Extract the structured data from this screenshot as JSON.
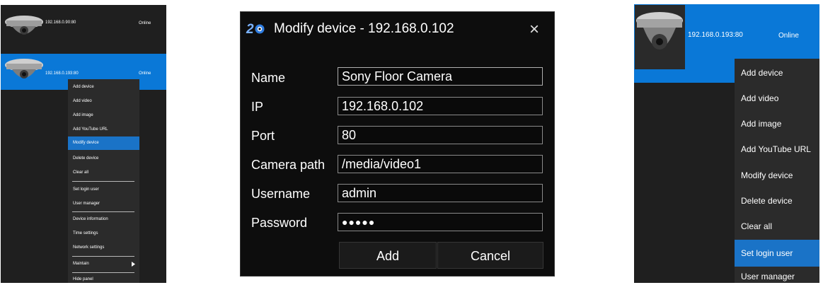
{
  "left": {
    "devices": [
      {
        "ip": "192.168.0.90:80",
        "status": "Online"
      },
      {
        "ip": "192.168.0.193:80",
        "status": "Online"
      }
    ],
    "menu": [
      {
        "label": "Add device"
      },
      {
        "label": "Add video"
      },
      {
        "label": "Add image"
      },
      {
        "label": "Add YouTube URL"
      },
      {
        "label": "Modify device"
      },
      {
        "label": "Delete device"
      },
      {
        "label": "Clear all"
      },
      {
        "label": "Set login user"
      },
      {
        "label": "User manager"
      },
      {
        "label": "Device information"
      },
      {
        "label": "Time settings"
      },
      {
        "label": "Network settings"
      },
      {
        "label": "Maintain"
      },
      {
        "label": "Hide panel"
      }
    ],
    "highlighted_item": "Modify device",
    "submenu_arrow_icon": "triangle-right-icon"
  },
  "dialog": {
    "logo": "2",
    "title": "Modify device - 192.168.0.102",
    "close_icon": "×",
    "fields": {
      "name": {
        "label": "Name",
        "value": "Sony Floor Camera"
      },
      "ip": {
        "label": "IP",
        "value": "192.168.0.102"
      },
      "port": {
        "label": "Port",
        "value": "80"
      },
      "path": {
        "label": "Camera path",
        "value": "/media/video1"
      },
      "username": {
        "label": "Username",
        "value": "admin"
      },
      "password": {
        "label": "Password",
        "value": "●●●●●"
      }
    },
    "buttons": {
      "add": "Add",
      "cancel": "Cancel"
    }
  },
  "right": {
    "device": {
      "ip": "192.168.0.193:80",
      "status": "Online"
    },
    "menu": [
      {
        "label": "Add device"
      },
      {
        "label": "Add video"
      },
      {
        "label": "Add image"
      },
      {
        "label": "Add YouTube URL"
      },
      {
        "label": "Modify device"
      },
      {
        "label": "Delete device"
      },
      {
        "label": "Clear all"
      },
      {
        "label": "Set login user"
      },
      {
        "label": "User manager"
      }
    ],
    "highlighted_item": "Set login user"
  },
  "colors": {
    "accent": "#0a78d7",
    "panel": "#1f1f1f",
    "dialog": "#0d0d0d"
  }
}
